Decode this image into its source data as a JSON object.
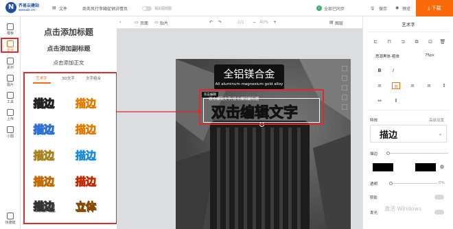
{
  "brand": {
    "name": "齐易云建站",
    "url": "weeab.cn",
    "logo_letter": "N"
  },
  "topbar": {
    "file": "文件",
    "doc_title": "商务风行李箱促销详情页",
    "toggle_label": "相关图效图",
    "status": "全部已同步",
    "save": "保存",
    "preview": "预览",
    "download": "下载"
  },
  "rail": [
    {
      "label": "模板"
    },
    {
      "label": "文字"
    },
    {
      "label": "素材"
    },
    {
      "label": "图片"
    },
    {
      "label": "工具"
    },
    {
      "label": "上传"
    },
    {
      "label": "小图"
    }
  ],
  "rail_bottom": "快捷键",
  "text_panel": {
    "add_title": "点击添加标题",
    "add_subtitle": "点击添加副标题",
    "add_body": "点击添加正文"
  },
  "tabs": [
    "艺术字",
    "3D文字",
    "文字组合"
  ],
  "styles": [
    "描边",
    "描边",
    "描边",
    "描边",
    "描边",
    "描边",
    "描边",
    "描边",
    "描边",
    "描边",
    "描边",
    "立体"
  ],
  "canvas_toolbar": {
    "page": "页面",
    "transparent": "贴片",
    "count": "1/1",
    "zoom": "40%",
    "layers": "图层"
  },
  "poster": {
    "title": "全铝镁合金",
    "subtitle": "All aluminum magnesium gold alloy",
    "tag": "双击编辑",
    "small_text": "双击编辑文字/双击编辑副标题",
    "big_text": "双击编辑文字"
  },
  "right_panel": {
    "heading": "艺术字",
    "font": "思源黑体-粗体",
    "size": "75px",
    "effects_label": "特效",
    "advanced": "高级设置",
    "preview": "描边",
    "stroke_label": "描边",
    "transparency": "透明",
    "transparency_value": "0%",
    "shadow": "阴影",
    "glow": "发光"
  },
  "watermark": "激活 Windows",
  "colors": {
    "accent": "#fa6a0a",
    "red": "#e02a2a",
    "blue": "#1e4ea8"
  }
}
